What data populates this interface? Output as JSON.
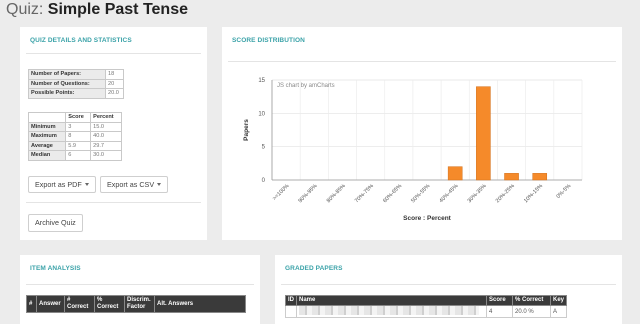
{
  "page": {
    "title_prefix": "Quiz:",
    "title_name": "Simple Past Tense"
  },
  "details": {
    "heading": "QUIZ DETAILS AND STATISTICS",
    "info_rows": [
      {
        "label": "Number of Papers:",
        "value": "18"
      },
      {
        "label": "Number of Questions:",
        "value": "20"
      },
      {
        "label": "Possible Points:",
        "value": "20.0"
      }
    ],
    "stats_headers": [
      "",
      "Score",
      "Percent"
    ],
    "stats_rows": [
      {
        "label": "Minimum",
        "score": "3",
        "percent": "15.0"
      },
      {
        "label": "Maximum",
        "score": "8",
        "percent": "40.0"
      },
      {
        "label": "Average",
        "score": "5.9",
        "percent": "29.7"
      },
      {
        "label": "Median",
        "score": "6",
        "percent": "30.0"
      }
    ],
    "export_pdf": "Export as PDF",
    "export_csv": "Export as CSV",
    "archive": "Archive Quiz"
  },
  "distribution": {
    "heading": "SCORE DISTRIBUTION",
    "watermark": "JS chart by amCharts"
  },
  "chart_data": {
    "type": "bar",
    "categories": [
      ">=100%",
      "90%-95%",
      "80%-85%",
      "70%-75%",
      "60%-65%",
      "50%-55%",
      "40%-45%",
      "30%-35%",
      "20%-25%",
      "10%-15%",
      "0%-5%"
    ],
    "values": [
      0,
      0,
      0,
      0,
      0,
      0,
      2,
      14,
      1,
      1,
      0
    ],
    "xlabel": "Score : Percent",
    "ylabel": "Papers",
    "ylim": [
      0,
      15
    ],
    "yticks": [
      0,
      5,
      10,
      15
    ],
    "grid": true,
    "bar_color": "#f58a2a"
  },
  "item_analysis": {
    "heading": "ITEM ANALYSIS",
    "headers": [
      "#",
      "Answer",
      "# Correct",
      "% Correct",
      "Discrim. Factor",
      "Alt. Answers"
    ]
  },
  "graded": {
    "heading": "GRADED PAPERS",
    "headers": [
      "ID",
      "Name",
      "Score",
      "% Correct",
      "Key"
    ],
    "rows": [
      {
        "id": "",
        "score": "4",
        "percent": "20.0 %",
        "key": "A"
      }
    ]
  },
  "colors": {
    "accent": "#3aa2a8",
    "background": "#ececec",
    "header_dark": "#3a3a3a"
  }
}
